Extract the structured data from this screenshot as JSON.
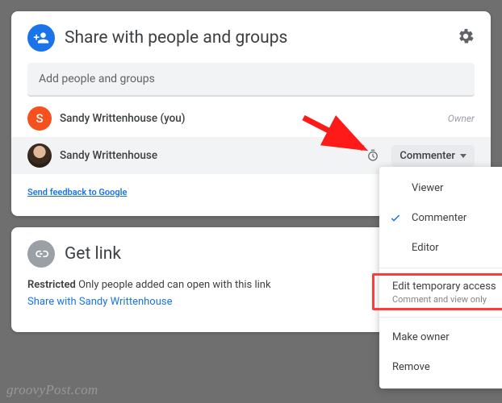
{
  "share": {
    "title": "Share with people and groups",
    "search_placeholder": "Add people and groups",
    "people": [
      {
        "initial": "S",
        "name": "Sandy Writtenhouse (you)",
        "role": "Owner"
      },
      {
        "name": "Sandy Writtenhouse",
        "role": "Commenter"
      }
    ],
    "feedback": "Send feedback to Google"
  },
  "link": {
    "title": "Get link",
    "restricted_label": "Restricted",
    "restricted_text": "Only people added can open with this link",
    "share_with": "Share with Sandy Writtenhouse"
  },
  "dropdown": {
    "viewer": "Viewer",
    "commenter": "Commenter",
    "editor": "Editor",
    "edit_temp": "Edit temporary access",
    "edit_temp_sub": "Comment and view only",
    "make_owner": "Make owner",
    "remove": "Remove"
  },
  "watermark": "groovyPost.com"
}
